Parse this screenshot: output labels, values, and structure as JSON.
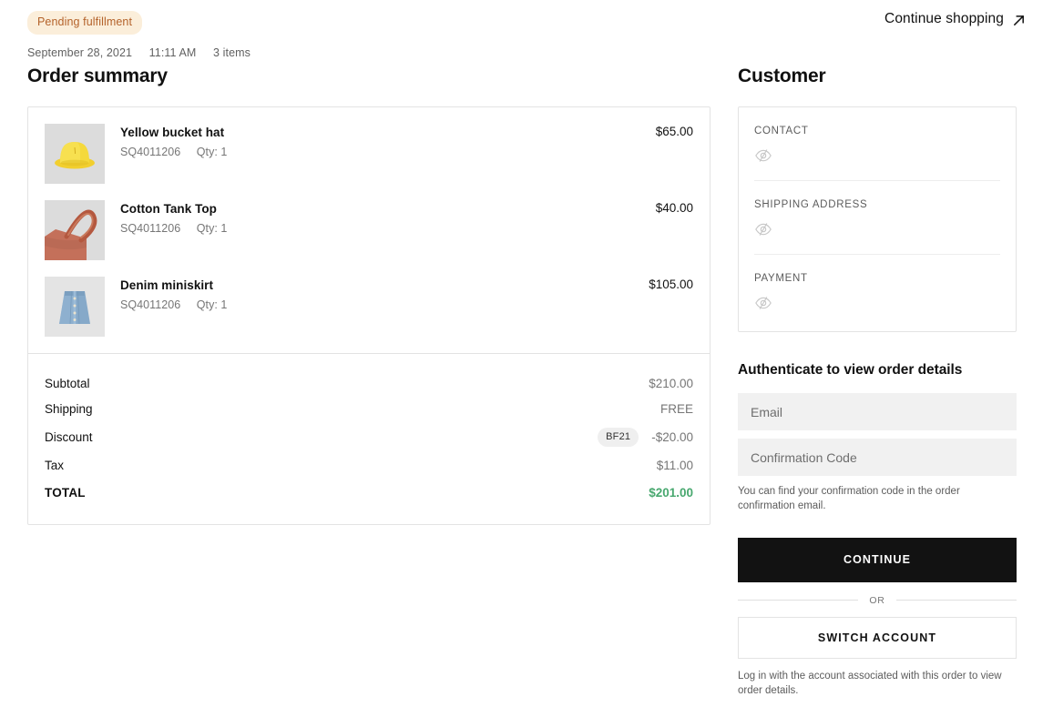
{
  "header": {
    "status_badge": "Pending fulfillment",
    "date": "September 28, 2021",
    "time": "11:11 AM",
    "item_count": "3 items",
    "continue_shopping": "Continue shopping",
    "continue_shopping_icon": "arrow-up-right-icon"
  },
  "order_summary": {
    "title": "Order summary",
    "items": [
      {
        "name": "Yellow bucket hat",
        "sku": "SQ4011206",
        "qty": "Qty: 1",
        "price": "$65.00",
        "image": "yellow-bucket-hat"
      },
      {
        "name": "Cotton Tank Top",
        "sku": "SQ4011206",
        "qty": "Qty: 1",
        "price": "$40.00",
        "image": "cotton-tank-top"
      },
      {
        "name": "Denim miniskirt",
        "sku": "SQ4011206",
        "qty": "Qty: 1",
        "price": "$105.00",
        "image": "denim-miniskirt"
      }
    ],
    "totals": {
      "subtotal_label": "Subtotal",
      "subtotal_value": "$210.00",
      "shipping_label": "Shipping",
      "shipping_value": "FREE",
      "discount_label": "Discount",
      "discount_code": "BF21",
      "discount_value": "-$20.00",
      "tax_label": "Tax",
      "tax_value": "$11.00",
      "total_label": "TOTAL",
      "total_value": "$201.00"
    }
  },
  "customer": {
    "title": "Customer",
    "blocks": [
      {
        "label": "CONTACT",
        "icon": "eye-off-icon"
      },
      {
        "label": "SHIPPING ADDRESS",
        "icon": "eye-off-icon"
      },
      {
        "label": "PAYMENT",
        "icon": "eye-off-icon"
      }
    ]
  },
  "auth": {
    "title": "Authenticate to view order details",
    "email_placeholder": "Email",
    "email_value": "",
    "code_placeholder": "Confirmation Code",
    "code_value": "",
    "help_text": "You can find your confirmation code in the order confirmation email.",
    "continue_button": "CONTINUE",
    "or_text": "OR",
    "switch_account_button": "SWITCH ACCOUNT",
    "footnote": "Log in with the account associated with this order to view order details."
  },
  "colors": {
    "badge_bg": "#fbeeda",
    "badge_text": "#b4622a",
    "total_green": "#48a86f",
    "primary_button": "#121212",
    "field_bg": "#f1f1f1",
    "card_border": "#e3e3e3"
  }
}
